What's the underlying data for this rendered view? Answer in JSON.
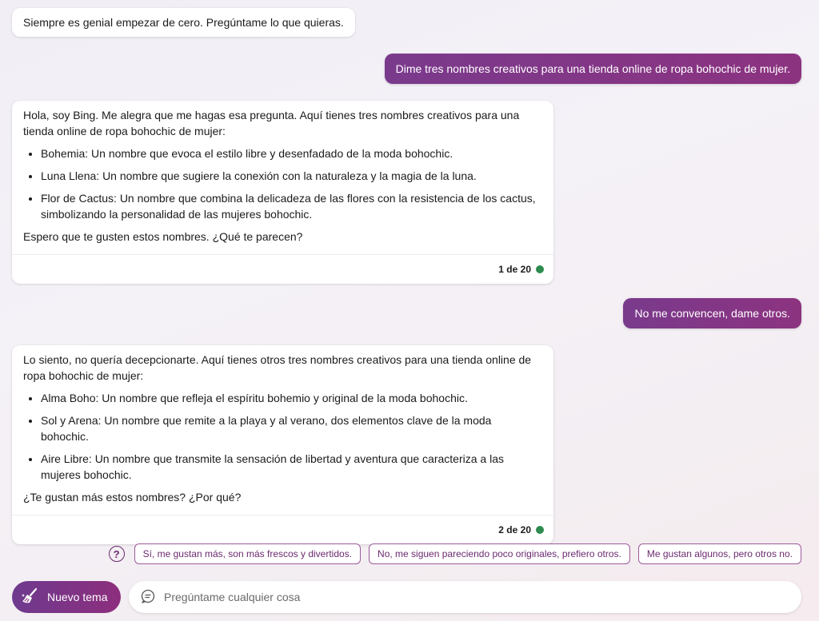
{
  "messages": {
    "greeting": "Siempre es genial empezar de cero. Pregúntame lo que quieras.",
    "user1": "Dime tres nombres creativos para una tienda online de ropa bohochic de mujer.",
    "bot1": {
      "intro": "Hola, soy Bing. Me alegra que me hagas esa pregunta. Aquí tienes tres nombres creativos para una tienda online de ropa bohochic de mujer:",
      "items": [
        "Bohemia: Un nombre que evoca el estilo libre y desenfadado de la moda bohochic.",
        "Luna Llena: Un nombre que sugiere la conexión con la naturaleza y la magia de la luna.",
        "Flor de Cactus: Un nombre que combina la delicadeza de las flores con la resistencia de los cactus, simbolizando la personalidad de las mujeres bohochic."
      ],
      "outro": "Espero que te gusten estos nombres. ¿Qué te parecen?",
      "counter": "1 de 20"
    },
    "user2": "No me convencen, dame otros.",
    "bot2": {
      "intro": "Lo siento, no quería decepcionarte. Aquí tienes otros tres nombres creativos para una tienda online de ropa bohochic de mujer:",
      "items": [
        "Alma Boho: Un nombre que refleja el espíritu bohemio y original de la moda bohochic.",
        "Sol y Arena: Un nombre que remite a la playa y al verano, dos elementos clave de la moda bohochic.",
        "Aire Libre: Un nombre que transmite la sensación de libertad y aventura que caracteriza a las mujeres bohochic."
      ],
      "outro": "¿Te gustan más estos nombres? ¿Por qué?",
      "counter": "2 de 20"
    }
  },
  "suggestions": {
    "icon": "question-circle-icon",
    "help_glyph": "?",
    "items": [
      "Sí, me gustan más, son más frescos y divertidos.",
      "No, me siguen pareciendo poco originales, prefiero otros.",
      "Me gustan algunos, pero otros no."
    ]
  },
  "composer": {
    "new_topic_label": "Nuevo tema",
    "new_topic_icon": "broom-icon",
    "chat_icon": "chat-bubble-icon",
    "placeholder": "Pregúntame cualquier cosa",
    "value": ""
  },
  "colors": {
    "accent": "#8c3380",
    "status_dot": "#2e8b4f",
    "suggestion_border": "#9c5a9a"
  }
}
